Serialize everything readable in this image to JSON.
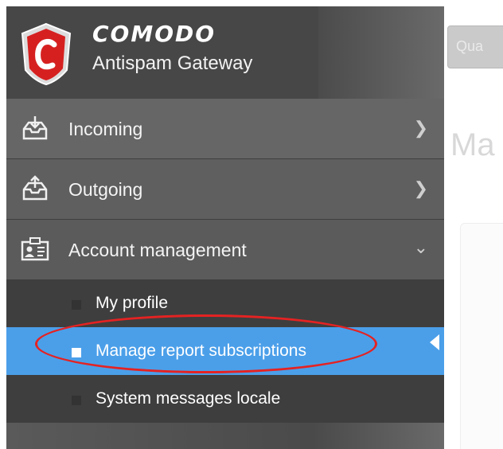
{
  "app": {
    "brand": "COMODO",
    "product": "Antispam Gateway",
    "top_button_label": "Qua",
    "page_title": "Ma"
  },
  "sidebar": {
    "items": [
      {
        "label": "Incoming",
        "icon": "inbox-download-icon",
        "expanded": false
      },
      {
        "label": "Outgoing",
        "icon": "inbox-upload-icon",
        "expanded": false
      },
      {
        "label": "Account management",
        "icon": "id-card-icon",
        "expanded": true,
        "children": [
          {
            "label": "My profile",
            "active": false
          },
          {
            "label": "Manage report subscriptions",
            "active": true
          },
          {
            "label": "System messages locale",
            "active": false
          }
        ]
      }
    ]
  },
  "colors": {
    "active": "#4b9fe9",
    "annotation": "#e52222"
  }
}
